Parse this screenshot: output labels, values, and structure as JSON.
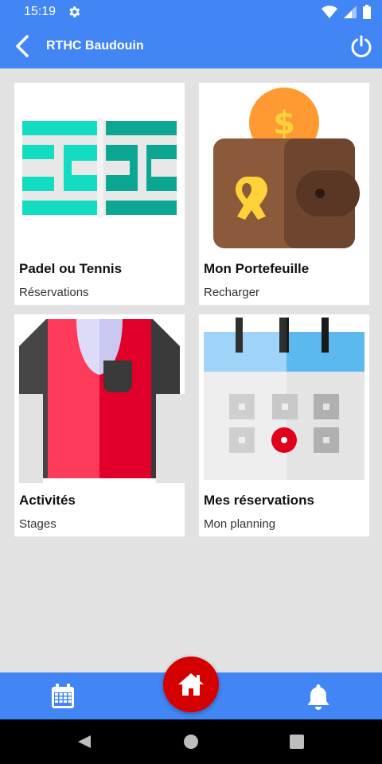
{
  "status": {
    "time": "15:19"
  },
  "app": {
    "title": "RTHC Baudouin"
  },
  "cards": [
    {
      "title": "Padel ou Tennis",
      "subtitle": "Réservations"
    },
    {
      "title": "Mon Portefeuille",
      "subtitle": "Recharger"
    },
    {
      "title": "Activités",
      "subtitle": "Stages"
    },
    {
      "title": "Mes réservations",
      "subtitle": "Mon planning"
    }
  ],
  "icons": {
    "status": [
      "settings-icon",
      "wifi-icon",
      "signal-icon",
      "battery-icon"
    ],
    "appbar": [
      "back-arrow-icon",
      "power-icon"
    ],
    "nav": [
      "calendar-icon",
      "home-icon",
      "bell-icon"
    ],
    "system": [
      "system-back-icon",
      "system-home-icon",
      "system-recents-icon"
    ]
  },
  "colors": {
    "primary": "#4285f4",
    "fab": "#d50000",
    "background": "#e2e2e2"
  }
}
